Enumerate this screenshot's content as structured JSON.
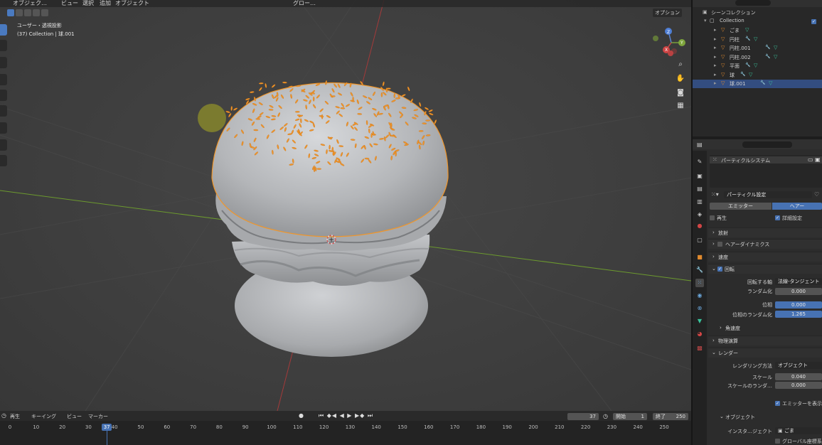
{
  "viewport": {
    "menus": [
      "オブジェク…",
      "ビュー",
      "選択",
      "追加",
      "オブジェクト"
    ],
    "header_right": [
      "グロー…"
    ],
    "options_label": "オプション",
    "view_name": "ユーザー・透視投影",
    "collection_info": "(37) Collection | 球.001",
    "gizmo": {
      "x": "X",
      "y": "Y",
      "z": "Z"
    }
  },
  "outliner": {
    "scene_collection": "シーンコレクション",
    "collection": "Collection",
    "items": [
      {
        "name": "ごま",
        "selected": false
      },
      {
        "name": "円柱",
        "selected": false
      },
      {
        "name": "円柱.001",
        "selected": false
      },
      {
        "name": "円柱.002",
        "selected": false
      },
      {
        "name": "平面",
        "selected": false
      },
      {
        "name": "球",
        "selected": false
      },
      {
        "name": "球.001",
        "selected": true
      }
    ]
  },
  "properties": {
    "particle_system_label": "パーティクルシステム",
    "particle_settings": "パーティクル設定",
    "type_tabs": {
      "emitter": "エミッター",
      "hair": "ヘアー",
      "active": "hair"
    },
    "regrow_label": "再生",
    "advanced_label": "詳細設定",
    "panels": {
      "emission": "放射",
      "hair_dynamics": "ヘアーダイナミクス",
      "velocity": "速度",
      "rotation": "回転",
      "angular_velocity": "角速度",
      "physics": "物理演算",
      "render": "レンダー",
      "object": "オブジェクト"
    },
    "rotation": {
      "axis_label": "回転する軸",
      "axis_value": "法線-タンジェント",
      "randomize_label": "ランダム化",
      "randomize_value": "0.000",
      "phase_label": "位相",
      "phase_value": "0.000",
      "phase_random_label": "位相のランダム化",
      "phase_random_value": "1.265"
    },
    "render": {
      "method_label": "レンダリング方法",
      "method_value": "オブジェクト",
      "scale_label": "スケール",
      "scale_value": "0.040",
      "scale_random_label": "スケールのランダ…",
      "scale_random_value": "0.000",
      "show_emitter_label": "エミッターを表示"
    },
    "object": {
      "instance_label": "インスタ…ジェクト",
      "instance_value": "ごま",
      "global_coords_label": "グローバル座標系"
    }
  },
  "timeline": {
    "menus": [
      "再生",
      "キーイング",
      "ビュー",
      "マーカー"
    ],
    "current_frame": "37",
    "start_label": "開始",
    "start_value": "1",
    "end_label": "終了",
    "end_value": "250",
    "ticks": [
      "0",
      "10",
      "20",
      "30",
      "40",
      "50",
      "60",
      "70",
      "80",
      "90",
      "100",
      "110",
      "120",
      "130",
      "140",
      "150",
      "160",
      "170",
      "180",
      "190",
      "200",
      "210",
      "220",
      "230",
      "240",
      "250"
    ],
    "playhead_frame": 37
  },
  "colors": {
    "accent": "#4772b3",
    "selection_orange": "#f0962a",
    "mesh_gray": "#b8babd"
  }
}
